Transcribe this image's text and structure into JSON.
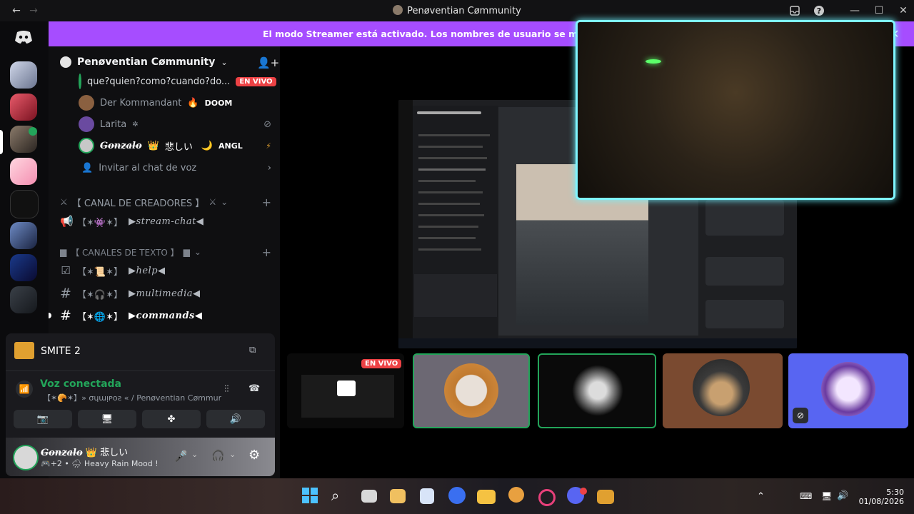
{
  "window": {
    "title": "Penøventian Cømmunity"
  },
  "banner": {
    "text": "El modo Streamer está activado. Los nombres de usuario se mostrarán de for"
  },
  "server": {
    "name": "Penøventian Cømmunity"
  },
  "voice_members": [
    {
      "name": "que?quien?como?cuando?do...",
      "badge": "EN VIVO"
    },
    {
      "name": "Der Kommandant",
      "activity": "DOOM"
    },
    {
      "name": "Larita"
    },
    {
      "name": "Gonzalo",
      "suffix": "悲しい",
      "tag": "ANGL"
    }
  ],
  "invite_label": "Invitar al chat de voz",
  "categories": {
    "creators": "【 CANAL DE CREADORES 】",
    "text": "【 CANALES DE TEXTO 】"
  },
  "channels": {
    "stream_chat": "▶stream-chat◀",
    "help": "▶help◀",
    "multimedia": "▶multimedia◀",
    "commands": "▶commands◀"
  },
  "game": {
    "name": "SMITE 2"
  },
  "voice": {
    "status": "Voz conectada",
    "channel": "【✶🥐✶】» σɥɯᴉᴘᴏƨ « / Penøventian Cømmun..."
  },
  "user": {
    "name": "Gonzalo",
    "suffix": "悲しい",
    "status": "+2 • 🌧 Heavy Rain Mood !"
  },
  "stage": {
    "live_badge": "EN VIVO"
  },
  "tray": {
    "time": "5:30",
    "date": "01/08/2026"
  },
  "colors": {
    "banner": "#a64dff",
    "live": "#ed4245",
    "voice_green": "#23a55a",
    "camera_border": "#7ff5ff"
  }
}
